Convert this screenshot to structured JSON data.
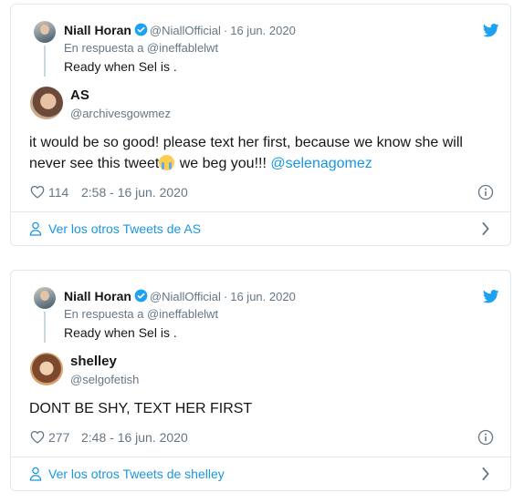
{
  "tweets": [
    {
      "reply": {
        "name": "Niall Horan",
        "handle": "@NiallOfficial",
        "separator": "·",
        "date": "16 jun. 2020",
        "reply_to": "En respuesta a @ineffablelwt",
        "text": "Ready when Sel is ."
      },
      "author": {
        "name": "AS",
        "handle": "@archivesgowmez"
      },
      "body": {
        "line1": "it would be so good! please text her first, because we know she will",
        "line2_pre": "never see this tweet",
        "line2_post": " we beg you!!! ",
        "mention": "@selenagomez"
      },
      "likes": "114",
      "timestamp": "2:58 - 16 jun. 2020",
      "more_link": "Ver los otros Tweets de AS"
    },
    {
      "reply": {
        "name": "Niall Horan",
        "handle": "@NiallOfficial",
        "separator": "·",
        "date": "16 jun. 2020",
        "reply_to": "En respuesta a @ineffablelwt",
        "text": "Ready when Sel is ."
      },
      "author": {
        "name": "shelley",
        "handle": "@selgofetish"
      },
      "body": {
        "line1": "DONT BE SHY, TEXT HER FIRST"
      },
      "likes": "277",
      "timestamp": "2:48 - 16 jun. 2020",
      "more_link": "Ver los otros Tweets de shelley"
    }
  ],
  "colors": {
    "accent": "#1b95e0",
    "muted": "#657786",
    "border": "#e1e8ed",
    "verified": "#1da1f2"
  },
  "icons": [
    "twitter-bird-icon",
    "verified-badge-icon",
    "heart-icon",
    "info-icon",
    "person-icon",
    "chevron-right-icon"
  ]
}
